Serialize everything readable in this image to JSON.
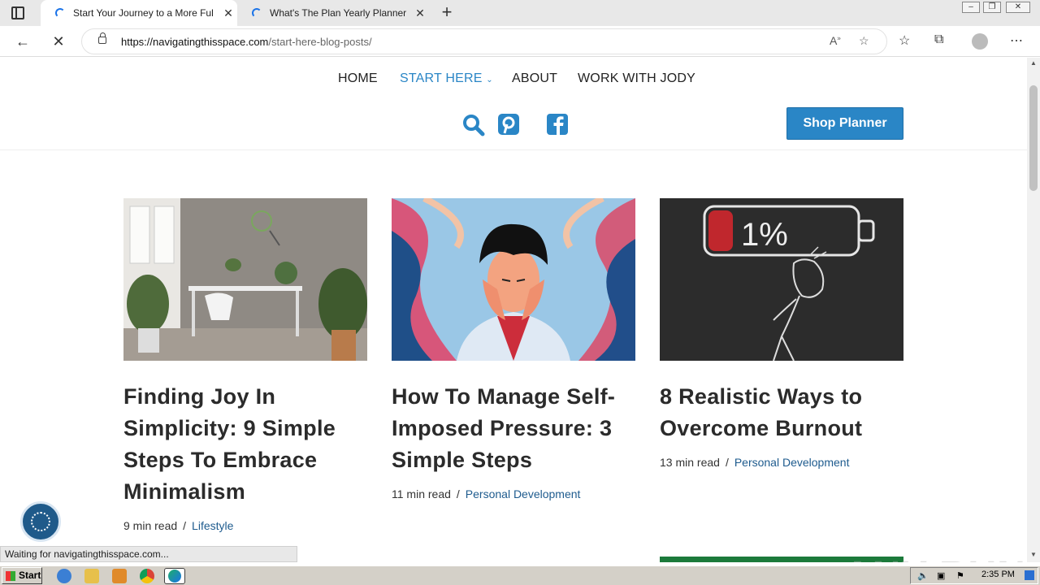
{
  "browser": {
    "tabs": [
      {
        "title": "Start Your Journey to a More Ful"
      },
      {
        "title": "What's The Plan Yearly Planner"
      }
    ],
    "url_host": "https://navigatingthisspace.com",
    "url_path": "/start-here-blog-posts/",
    "status": "Waiting for navigatingthisspace.com..."
  },
  "site": {
    "menu": [
      "HOME",
      "START HERE",
      "ABOUT",
      "WORK WITH JODY"
    ],
    "shop_button": "Shop Planner"
  },
  "posts": [
    {
      "title": "Finding Joy In Simplicity: 9 Simple Steps To Embrace Minimalism",
      "read_time": "9 min read",
      "separator": "/",
      "category": "Lifestyle"
    },
    {
      "title": "How To Manage Self-Imposed Pressure: 3 Simple Steps",
      "read_time": "11 min read",
      "separator": "/",
      "category": "Personal Development"
    },
    {
      "title": "8 Realistic Ways to Overcome Burnout",
      "read_time": "13 min read",
      "separator": "/",
      "category": "Personal Development",
      "battery_text": "1%"
    }
  ],
  "taskbar": {
    "start_label": "Start",
    "clock": "2:35 PM"
  },
  "watermark": "ANY RUN",
  "colors": {
    "accent": "#2a86c6",
    "link": "#1e5b8e",
    "heading": "#2b2b2b"
  }
}
